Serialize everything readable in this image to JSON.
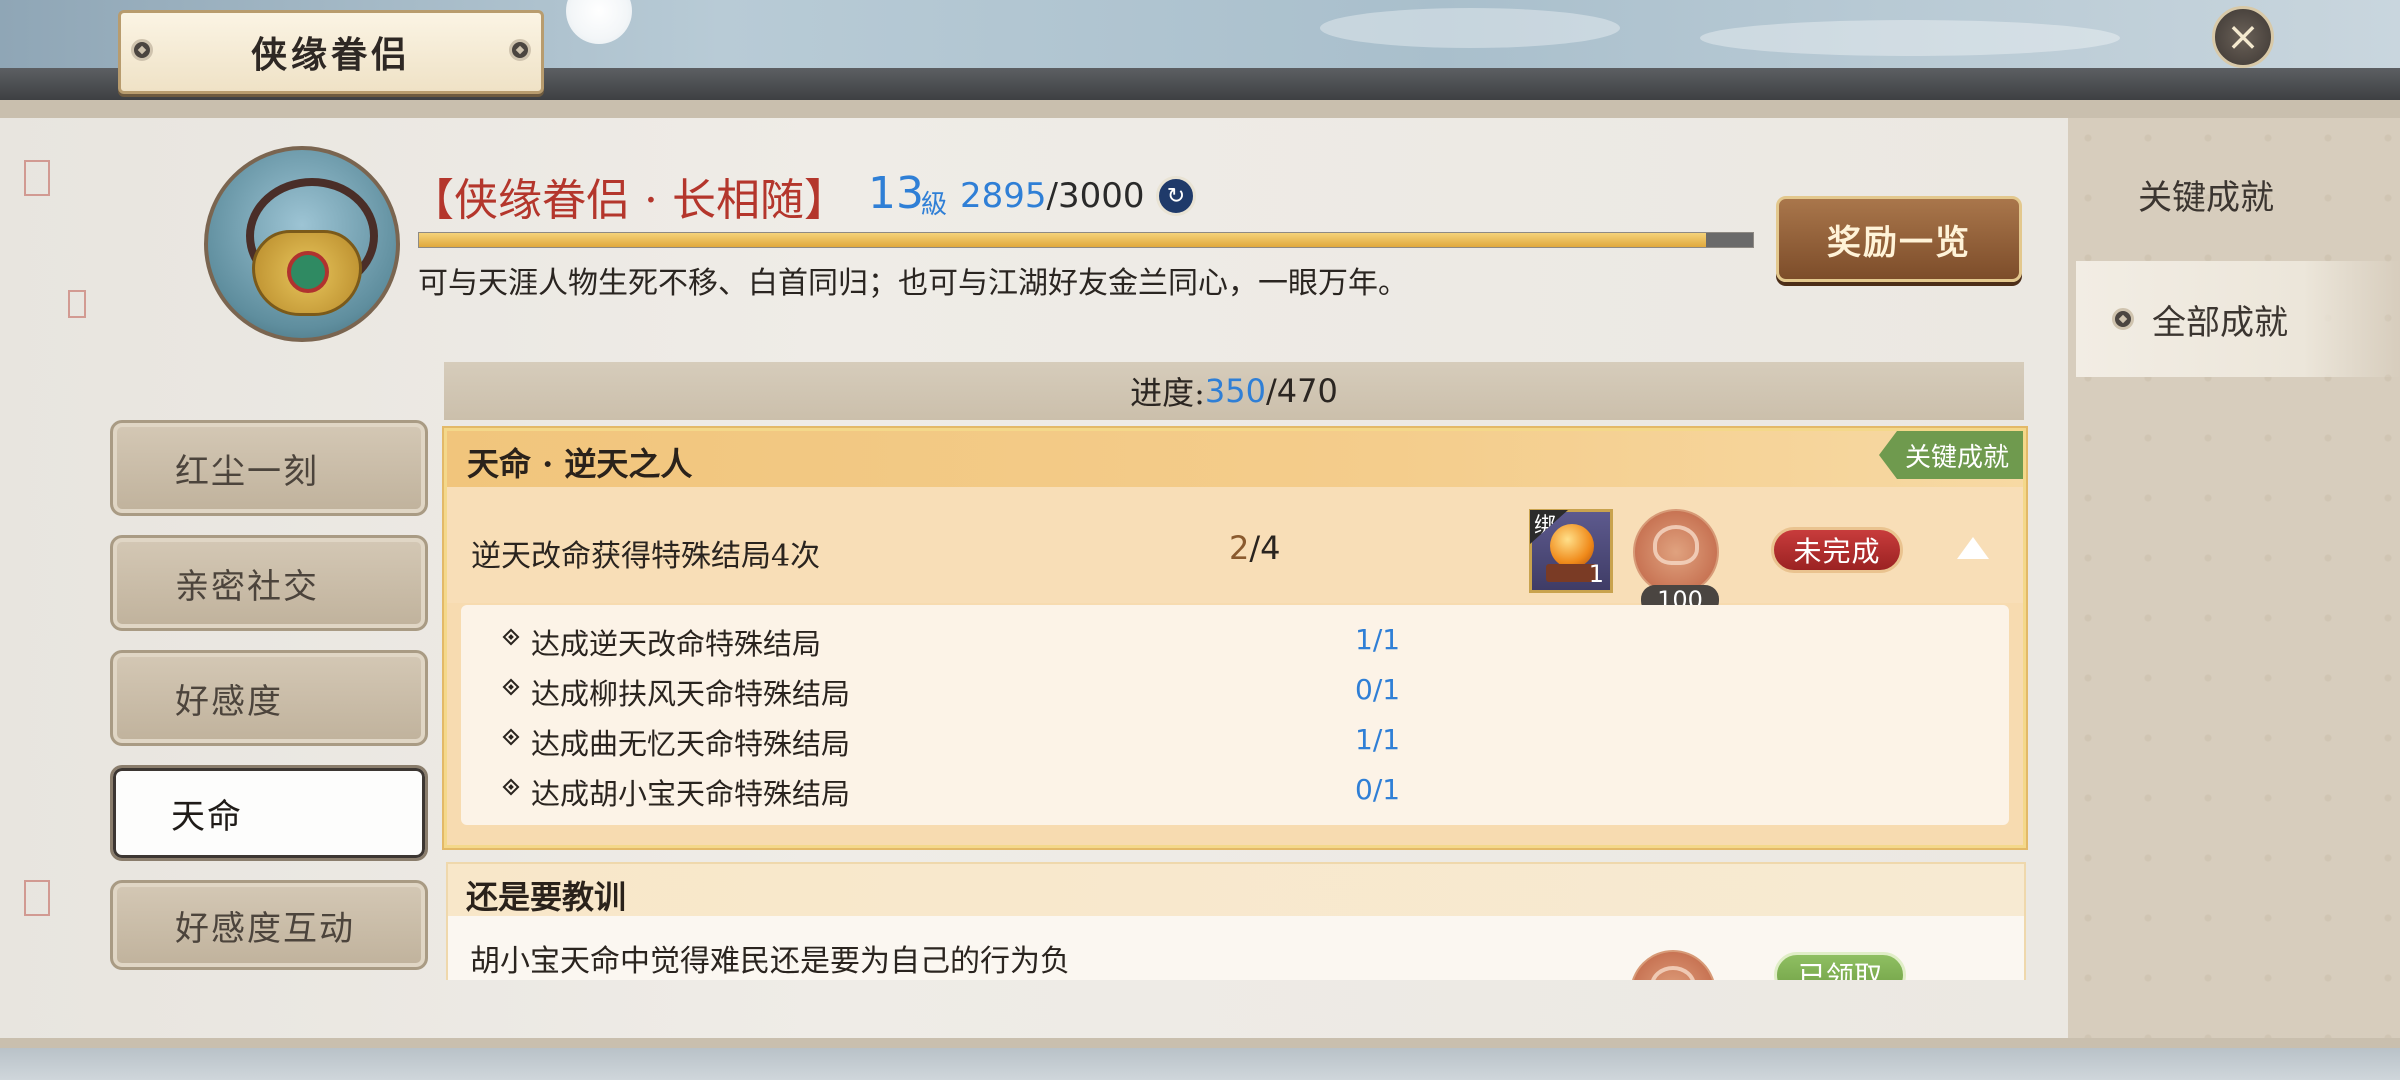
{
  "window": {
    "title": "侠缘眷侣"
  },
  "achievement": {
    "title": "【侠缘眷侣 · 长相随】",
    "level": "13",
    "level_unit": "級",
    "xp_current": "2895",
    "xp_sep_max": "/3000",
    "xp_fraction": 0.965,
    "description": "可与天涯人物生死不移、白首同归；也可与江湖好友金兰同心，一眼万年。",
    "reward_button": "奖励一览"
  },
  "right_tabs": [
    {
      "label": "关键成就"
    },
    {
      "label": "全部成就"
    }
  ],
  "progress": {
    "label": "进度:",
    "current": "350",
    "total": "/470"
  },
  "left_tabs": [
    {
      "label": "红尘一刻"
    },
    {
      "label": "亲密社交"
    },
    {
      "label": "好感度"
    },
    {
      "label": "天命"
    },
    {
      "label": "好感度互动"
    }
  ],
  "cards": [
    {
      "title": "天命 · 逆天之人",
      "tag": "关键成就",
      "desc": "逆天改命获得特殊结局4次",
      "count_done": "2",
      "count_total": "/4",
      "item_bind_label": "绑",
      "item_qty": "1",
      "coin_qty": "100",
      "status": "未完成",
      "sub": [
        {
          "text": "达成逆天改命特殊结局",
          "value": "1/1"
        },
        {
          "text": "达成柳扶风天命特殊结局",
          "value": "0/1"
        },
        {
          "text": "达成曲无忆天命特殊结局",
          "value": "1/1"
        },
        {
          "text": "达成胡小宝天命特殊结局",
          "value": "0/1"
        }
      ]
    },
    {
      "title": "还是要教训",
      "desc": "胡小宝天命中觉得难民还是要为自己的行为负",
      "status": "已领取"
    }
  ],
  "colors": {
    "accent_blue": "#2f7fd6",
    "title_red": "#b4362c",
    "status_red": "#b52e2e",
    "claimed_green": "#7fb052",
    "key_tag_green": "#6f9a4e"
  }
}
